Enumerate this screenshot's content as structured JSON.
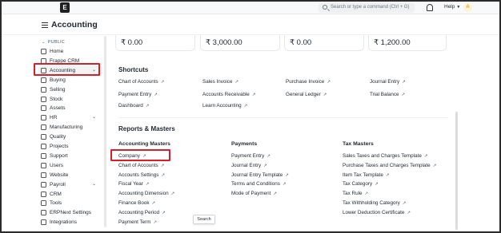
{
  "navbar": {
    "logo_letter": "E",
    "search_placeholder": "Search or type a command (Ctrl + G)",
    "help_label": "Help",
    "avatar_initial": "A"
  },
  "page": {
    "title": "Accounting"
  },
  "sidebar": {
    "section_label": "PUBLIC",
    "items": [
      {
        "label": "Home",
        "icon": "home-icon"
      },
      {
        "label": "Frappe CRM",
        "icon": "crm-icon"
      },
      {
        "label": "Accounting",
        "icon": "accounting-icon",
        "expandable": true
      },
      {
        "label": "Buying",
        "icon": "cart-icon"
      },
      {
        "label": "Selling",
        "icon": "tag-icon"
      },
      {
        "label": "Stock",
        "icon": "box-icon"
      },
      {
        "label": "Assets",
        "icon": "assets-icon"
      },
      {
        "label": "HR",
        "icon": "hr-icon",
        "expandable": true
      },
      {
        "label": "Manufacturing",
        "icon": "factory-icon"
      },
      {
        "label": "Quality",
        "icon": "quality-icon"
      },
      {
        "label": "Projects",
        "icon": "projects-icon"
      },
      {
        "label": "Support",
        "icon": "support-icon"
      },
      {
        "label": "Users",
        "icon": "users-icon"
      },
      {
        "label": "Website",
        "icon": "website-icon"
      },
      {
        "label": "Payroll",
        "icon": "payroll-icon",
        "expandable": true
      },
      {
        "label": "CRM",
        "icon": "crm-icon"
      },
      {
        "label": "Tools",
        "icon": "tools-icon"
      },
      {
        "label": "ERPNext Settings",
        "icon": "settings-icon"
      },
      {
        "label": "Integrations",
        "icon": "integrations-icon"
      }
    ],
    "chevron": "⌄"
  },
  "cards": [
    {
      "value": "₹ 0.00"
    },
    {
      "value": "₹ 3,000.00"
    },
    {
      "value": "₹ 0.00"
    },
    {
      "value": "₹ 1,200.00"
    }
  ],
  "shortcuts": {
    "title": "Shortcuts",
    "links": [
      "Chart of Accounts",
      "Sales Invoice",
      "Purchase Invoice",
      "Journal Entry",
      "Payment Entry",
      "Accounts Receivable",
      "General Ledger",
      "Trial Balance",
      "Dashboard",
      "Learn Accounting"
    ]
  },
  "reports": {
    "title": "Reports & Masters",
    "columns": [
      {
        "heading": "Accounting Masters",
        "links": [
          "Company",
          "Chart of Accounts",
          "Accounts Settings",
          "Fiscal Year",
          "Accounting Dimension",
          "Finance Book",
          "Accounting Period",
          "Payment Term"
        ]
      },
      {
        "heading": "Payments",
        "links": [
          "Payment Entry",
          "Journal Entry",
          "Journal Entry Template",
          "Terms and Conditions",
          "Mode of Payment"
        ]
      },
      {
        "heading": "Tax Masters",
        "links": [
          "Sales Taxes and Charges Template",
          "Purchase Taxes and Charges Template",
          "Item Tax Template",
          "Tax Category",
          "Tax Rule",
          "Tax Withholding Category",
          "Lower Deduction Certificate"
        ]
      }
    ]
  },
  "link_arrow": "↗",
  "tooltip": "Search",
  "highlight_color": "#d4202a"
}
